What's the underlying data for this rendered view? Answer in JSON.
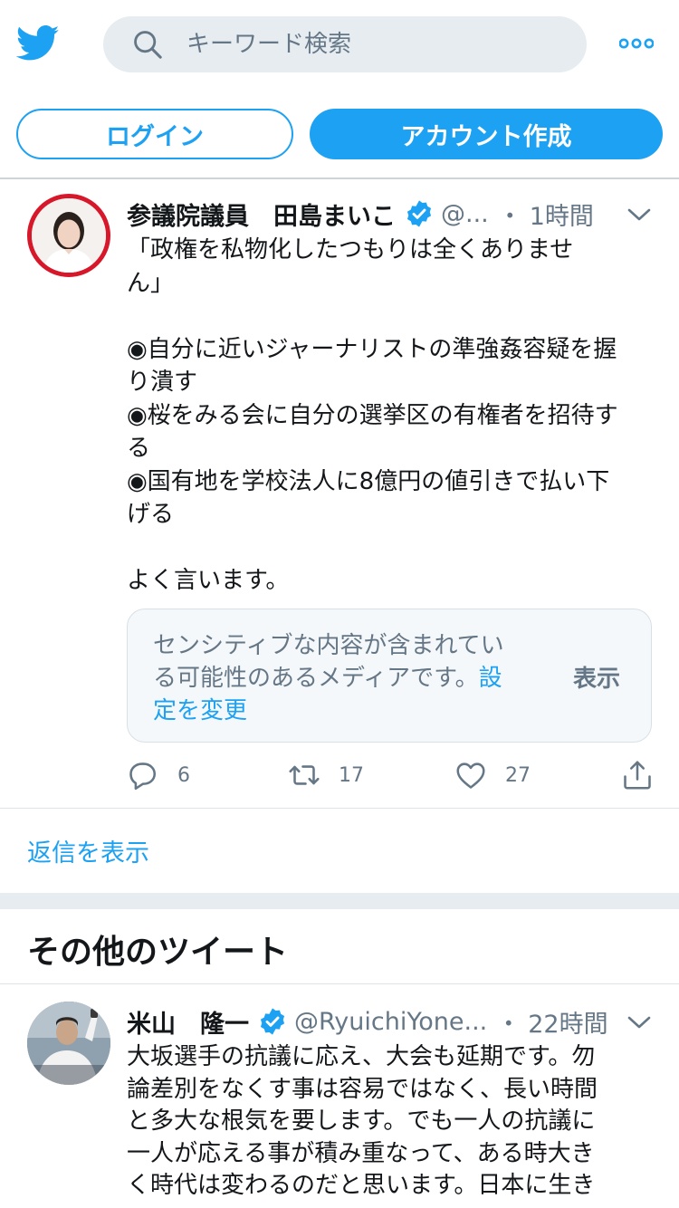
{
  "header": {
    "search_placeholder": "キーワード検索"
  },
  "auth": {
    "login_label": "ログイン",
    "signup_label": "アカウント作成"
  },
  "tweet1": {
    "name": "参議院議員　田島まいこ",
    "handle": "@...",
    "separator": "・",
    "time": "1時間",
    "text": "「政権を私物化したつもりは全くありませ\nん」\n\n◉自分に近いジャーナリストの準強姦容疑を握\nり潰す\n◉桜をみる会に自分の選挙区の有権者を招待す\nる\n◉国有地を学校法人に8億円の値引きで払い下\nげる\n\nよく言います。",
    "sensitive_notice": "センシティブな内容が含まれてい\nる可能性のあるメディアです。",
    "sensitive_link": "設\n定を変更",
    "sensitive_show": "表示",
    "reply_count": "6",
    "retweet_count": "17",
    "like_count": "27"
  },
  "show_replies_label": "返信を表示",
  "more_tweets_title": "その他のツイート",
  "tweet2": {
    "name": "米山　隆一",
    "handle": "@RyuichiYone...",
    "separator": "・",
    "time": "22時間",
    "text": "大坂選手の抗議に応え、大会も延期です。勿\n論差別をなくす事は容易ではなく、長い時間\nと多大な根気を要します。でも一人の抗議に\n一人が応える事が積み重なって、ある時大き\nく時代は変わるのだと思います。日本に生き"
  },
  "colors": {
    "accent": "#1da1f2",
    "text": "#14171a",
    "muted": "#657786",
    "search_bg": "#e6ecf0",
    "avatar_ring": "#d7182a"
  },
  "icons": [
    "twitter-bird-icon",
    "search-icon",
    "more-dots-icon",
    "verified-badge-icon",
    "chevron-down-icon",
    "reply-icon",
    "retweet-icon",
    "like-icon",
    "share-icon"
  ]
}
